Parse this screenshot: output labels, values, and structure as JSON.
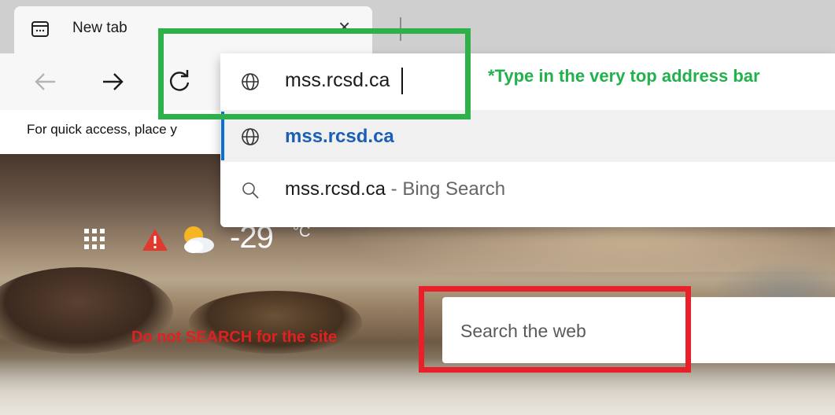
{
  "tab": {
    "title": "New tab",
    "close_glyph": "×"
  },
  "toolbar": {
    "back_icon": "back-arrow-icon",
    "forward_icon": "forward-arrow-icon",
    "refresh_icon": "refresh-icon"
  },
  "favorites_bar": {
    "text": "For quick access, place y"
  },
  "address_bar": {
    "value": "mss.rcsd.ca"
  },
  "suggestions": [
    {
      "icon": "globe-icon",
      "text": "mss.rcsd.ca",
      "suffix": ""
    },
    {
      "icon": "search-icon",
      "text": "mss.rcsd.ca",
      "suffix": " - Bing Search"
    }
  ],
  "annotations": {
    "green_note": "*Type in the very top address bar",
    "red_note": "Do not SEARCH for the site"
  },
  "newtab_page": {
    "temperature": "-29",
    "unit": "°C",
    "search_placeholder": "Search the web"
  },
  "colors": {
    "green_annotation": "#2eb04b",
    "red_annotation": "#e8202a",
    "suggestion_link": "#1a5fb4"
  }
}
